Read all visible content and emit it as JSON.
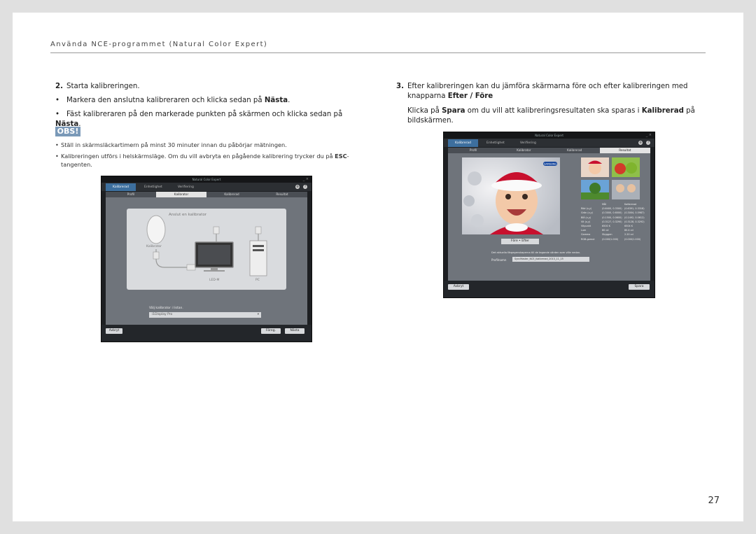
{
  "header": {
    "title": "Använda NCE-programmet (Natural Color Expert)"
  },
  "left": {
    "step_num": "2.",
    "step_text": "Starta kalibreringen.",
    "bullet1_pre": "Markera den anslutna kalibreraren och klicka sedan på ",
    "bullet1_bold": "Nästa",
    "bullet1_post": ".",
    "bullet2_pre": "Fäst kalibreraren på den markerade punkten på skärmen och klicka sedan på ",
    "bullet2_bold": "Nästa",
    "bullet2_post": ".",
    "obs_label": "OBS!",
    "note1": "Ställ in skärmsläckartimern på minst 30 minuter innan du påbörjar mätningen.",
    "note2_pre": "Kalibreringen utförs i helskärmsläge. Om du vill avbryta en pågående kalibrering trycker du på ",
    "note2_bold": "ESC",
    "note2_post": "-",
    "note2_line2": "tangenten."
  },
  "right": {
    "step_num": "3.",
    "line1": "Efter kalibreringen kan du jämföra skärmarna före och efter kalibreringen med",
    "line2_pre": "knapparna ",
    "line2_bold": "Efter / Före",
    "p2_pre": "Klicka på ",
    "p2_bold1": "Spara",
    "p2_mid": " om du vill att kalibreringsresultaten ska sparas i ",
    "p2_bold2": "Kalibrerad",
    "p2_post": " på",
    "p2_line2": "bildskärmen."
  },
  "app1": {
    "title": "Natural Color Expert",
    "tabs": [
      "Kalibrerad",
      "Enhetlighet",
      "Verifiering"
    ],
    "steps": [
      "Profil",
      "Kalibrator",
      "Kalibrerad",
      "Resultat"
    ],
    "panel_title": "Anslut en kalibrator",
    "calibrator_label": "Kalibrator",
    "monitor_label": "LED-M",
    "pc_label": "PC",
    "select_label": "Välj kalibrator i listan.",
    "select_value": "i1Display Pro",
    "btn_cancel": "Avbryt",
    "btn_prev": "Föreg.",
    "btn_next": "Nästa"
  },
  "app2": {
    "title": "Natural Color Expert",
    "tabs": [
      "Kalibrerad",
      "Enhetlighet",
      "Verifiering"
    ],
    "steps": [
      "Profil",
      "Kalibrator",
      "Kalibrerad",
      "Resultat"
    ],
    "brand": "SAMSUNG",
    "toggle_label": "Före  •  Efter",
    "table_header": [
      "Mål",
      "Kalibrerad"
    ],
    "table_rows": [
      [
        "Röd (x,y)",
        "(0.6400, 0.3300)",
        "(0.6391, 0.3318)"
      ],
      [
        "Grön (x,y)",
        "(0.3000, 0.6000)",
        "(0.3004, 0.5987)"
      ],
      [
        "Blå (x,y)",
        "(0.1500, 0.0600)",
        "(0.1492, 0.0612)"
      ],
      [
        "Vit (x,y)",
        "(0.3127, 0.3290)",
        "(0.3128, 0.3292)"
      ],
      [
        "Vitpunkt",
        "6500 K",
        "6504 K"
      ],
      [
        "Lum",
        "80 cd",
        "80.4 cd"
      ],
      [
        "Gamma",
        "Skyggen",
        "2.20 cd"
      ],
      [
        "RGB-gamut",
        "(0.000/1.000)",
        "(0.000/1.000)"
      ]
    ],
    "info_text": "Det aktuella färgegenskaperna till de tagande värden som ville nedan.",
    "profile_label": "Profilnamn",
    "profile_value": "SyncMaster_NCE_Kalibrerad_2013_11_15",
    "btn_cancel": "Avbryt",
    "btn_save": "Spara"
  },
  "page_number": "27"
}
